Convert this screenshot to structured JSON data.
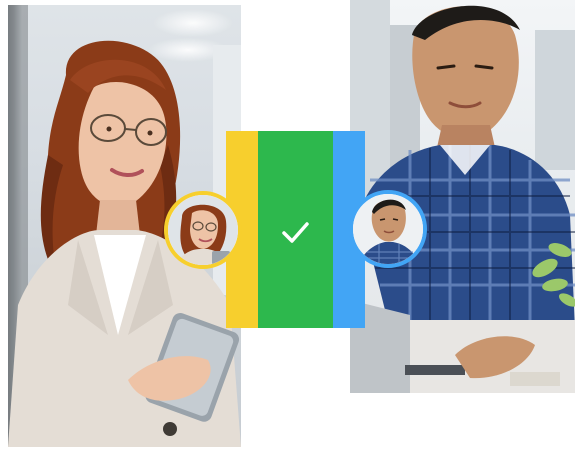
{
  "people": {
    "left": {
      "avatar_ring_color": "#f7cf2d"
    },
    "right": {
      "avatar_ring_color": "#42a5f5"
    }
  },
  "verification": {
    "bars": [
      {
        "color": "#f7cf2d"
      },
      {
        "color": "#2db84d"
      },
      {
        "color": "#42a5f5"
      }
    ],
    "icon": "check-icon"
  }
}
